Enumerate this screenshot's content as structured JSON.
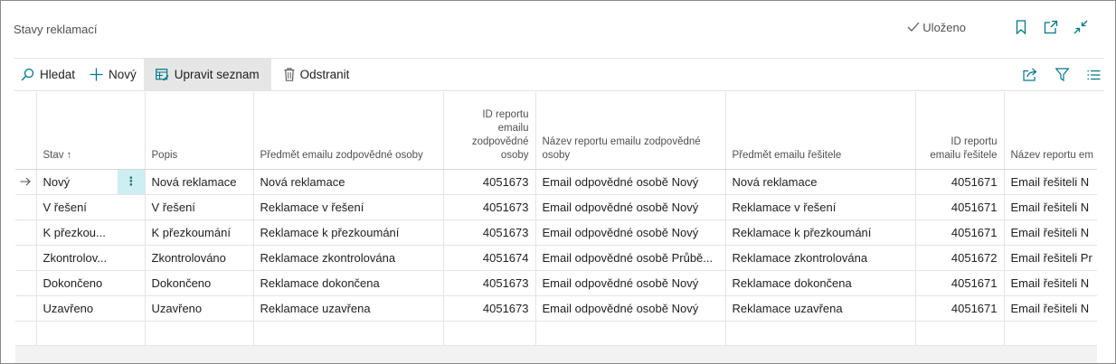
{
  "header": {
    "title": "Stavy reklamací",
    "saved_label": "Uloženo"
  },
  "actions": {
    "search": "Hledat",
    "new": "Nový",
    "edit_list": "Upravit seznam",
    "delete": "Odstranit"
  },
  "columns": {
    "stav": "Stav",
    "stav_sort": "↑",
    "popis": "Popis",
    "predmet_zodp": "Předmět emailu zodpovědné osoby",
    "id_zodp_l1": "ID reportu",
    "id_zodp_l2": "emailu",
    "id_zodp_l3": "zodpovědné",
    "id_zodp_l4": "osoby",
    "nazev_zodp_l1": "Název reportu emailu zodpovědné",
    "nazev_zodp_l2": "osoby",
    "predmet_res": "Předmět emailu řešitele",
    "id_res_l1": "ID reportu",
    "id_res_l2": "emailu řešitele",
    "nazev_res": "Název reportu em"
  },
  "rows": [
    {
      "stav": "Nový",
      "popis": "Nová reklamace",
      "predmet_zodp": "Nová reklamace",
      "id_zodp": "4051673",
      "nazev_zodp": "Email odpovědné osobě Nový",
      "predmet_res": "Nová reklamace",
      "id_res": "4051671",
      "nazev_res": "Email řešiteli N"
    },
    {
      "stav": "V řešení",
      "popis": "V řešení",
      "predmet_zodp": "Reklamace v řešení",
      "id_zodp": "4051673",
      "nazev_zodp": "Email odpovědné osobě Nový",
      "predmet_res": "Reklamace v řešení",
      "id_res": "4051671",
      "nazev_res": "Email řešiteli N"
    },
    {
      "stav": "K přezkou...",
      "popis": "K přezkoumání",
      "predmet_zodp": "Reklamace k přezkoumání",
      "id_zodp": "4051673",
      "nazev_zodp": "Email odpovědné osobě Nový",
      "predmet_res": "Reklamace k přezkoumání",
      "id_res": "4051671",
      "nazev_res": "Email řešiteli N"
    },
    {
      "stav": "Zkontrolov...",
      "popis": "Zkontrolováno",
      "predmet_zodp": "Reklamace zkontrolována",
      "id_zodp": "4051674",
      "nazev_zodp": "Email odpovědné osobě Průbě...",
      "predmet_res": "Reklamace zkontrolována",
      "id_res": "4051672",
      "nazev_res": "Email řešiteli Pr"
    },
    {
      "stav": "Dokončeno",
      "popis": "Dokončeno",
      "predmet_zodp": "Reklamace dokončena",
      "id_zodp": "4051673",
      "nazev_zodp": "Email odpovědné osobě Nový",
      "predmet_res": "Reklamace dokončena",
      "id_res": "4051671",
      "nazev_res": "Email řešiteli N"
    },
    {
      "stav": "Uzavřeno",
      "popis": "Uzavřeno",
      "predmet_zodp": "Reklamace uzavřena",
      "id_zodp": "4051673",
      "nazev_zodp": "Email odpovědné osobě Nový",
      "predmet_res": "Reklamace uzavřena",
      "id_res": "4051671",
      "nazev_res": "Email řešiteli N"
    }
  ],
  "row_menu_glyph": "⋮",
  "colors": {
    "accent": "#00788a",
    "selected_cell": "#cdeef2"
  }
}
